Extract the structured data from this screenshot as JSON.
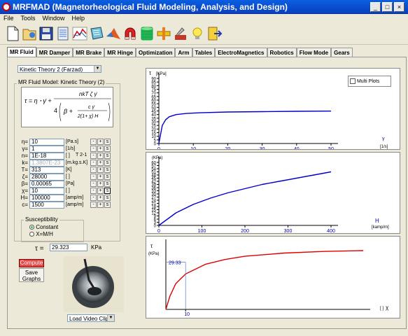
{
  "window": {
    "title": "MRFMAD (Magnetorheological Fluid Modeling, Analysis, and Design)"
  },
  "menu": [
    "File",
    "Tools",
    "Window",
    "Help"
  ],
  "toolbar_icons": [
    "new-file-icon",
    "open-file-icon",
    "save-icon",
    "database-icon",
    "chart-icon",
    "notebook-icon",
    "matlab-icon",
    "magnet-icon",
    "coil-icon",
    "damper-icon",
    "tools-icon",
    "lightbulb-icon",
    "exit-icon"
  ],
  "tabs": [
    "MR Fluid",
    "MR Damper",
    "MR Brake",
    "MR Hinge",
    "Optimization",
    "Arm",
    "Tables",
    "ElectroMagnetics",
    "Robotics",
    "Flow Mode",
    "Gears"
  ],
  "model_select": "Kinetic Theory 2 (Farzad)",
  "model_group_label": "MR Fluid Model: Kinetic Theory (2)",
  "params": [
    {
      "sym": "η=",
      "val": "10",
      "unit": "[Pa.s]"
    },
    {
      "sym": "γ=",
      "val": "1",
      "unit": "[1/s]"
    },
    {
      "sym": "n=",
      "val": "1E-18",
      "unit": "[ ]"
    },
    {
      "sym": "k=",
      "val": "1.3807E-23",
      "unit": "[m.kg.s.K]"
    },
    {
      "sym": "T=",
      "val": "313",
      "unit": "[K]"
    },
    {
      "sym": "ζ=",
      "val": "28000",
      "unit": "[ ]"
    },
    {
      "sym": "β=",
      "val": "0.00065",
      "unit": "[Pa]"
    },
    {
      "sym": "χ=",
      "val": "10",
      "unit": "[ ]"
    },
    {
      "sym": "H=",
      "val": "100000",
      "unit": "[amp/m]"
    },
    {
      "sym": "c=",
      "val": "1500",
      "unit": "[amp/m]"
    }
  ],
  "unit_annotation": "T    2-1",
  "susceptibility": {
    "label": "Susceptibility",
    "opt1": "Constant",
    "opt2": "X=M/H"
  },
  "result": {
    "sym": "τ  =",
    "val": "29.323",
    "unit": "KPa"
  },
  "compute_label": "Compute",
  "save_graphs_label": "Save Graphs",
  "load_video_label": "Load Video Clip",
  "chart1_ylabel": "τ",
  "chart1_yunit": "[KPa]",
  "chart1_xunit": "[1/s]",
  "chart1_xsym": "γ",
  "chart2_yunit": "(KPa)",
  "chart2_xlabel": "H",
  "chart2_xunit": "[kamp/m]",
  "chart3_ylabel": "τ",
  "chart3_yunit": "(KPa)",
  "chart3_xsym": "χ",
  "chart3_xunit": "[ ]",
  "multi_plots_label": "Multi Plots",
  "chart_data": [
    {
      "type": "line",
      "x": [
        0,
        1,
        2,
        3,
        5,
        8,
        12,
        20,
        30,
        40,
        50
      ],
      "y": [
        0,
        25,
        33,
        37,
        40,
        41.5,
        42.5,
        43.5,
        44,
        44.5,
        44.8
      ],
      "xticks": [
        0,
        10,
        20,
        30,
        40,
        50
      ],
      "yticks": [
        0,
        5,
        10,
        15,
        20,
        25,
        30,
        35,
        40,
        45,
        50,
        55,
        60,
        65,
        70,
        75,
        80,
        85,
        90
      ],
      "xlim": [
        0,
        50
      ],
      "ylim": [
        0,
        90
      ],
      "color": "#0000cc"
    },
    {
      "type": "line",
      "x": [
        0,
        40,
        80,
        120,
        160,
        200,
        240,
        280,
        320,
        360,
        400
      ],
      "y": [
        0,
        12,
        20,
        26,
        31,
        35,
        39,
        42,
        45,
        48,
        51
      ],
      "xticks": [
        0,
        100,
        200,
        300,
        400
      ],
      "yticks": [
        0,
        3,
        6,
        9,
        12,
        15,
        18,
        21,
        24,
        27,
        30,
        33,
        36,
        39,
        42,
        45,
        48,
        51,
        54,
        57,
        60
      ],
      "xlim": [
        0,
        400
      ],
      "ylim": [
        0,
        60
      ],
      "color": "#0000cc"
    },
    {
      "type": "line",
      "x": [
        0,
        2,
        5,
        10,
        20,
        30,
        40,
        60,
        80,
        100
      ],
      "y": [
        0,
        8,
        16,
        22,
        28,
        31,
        33,
        35,
        36,
        36.5
      ],
      "xticks": [
        10
      ],
      "xlim": [
        0,
        100
      ],
      "ylim": [
        0,
        40
      ],
      "marker": {
        "x": 10,
        "y": 29.323,
        "label": "29.33",
        "xlabel": "10"
      },
      "color": "#e00000"
    }
  ]
}
